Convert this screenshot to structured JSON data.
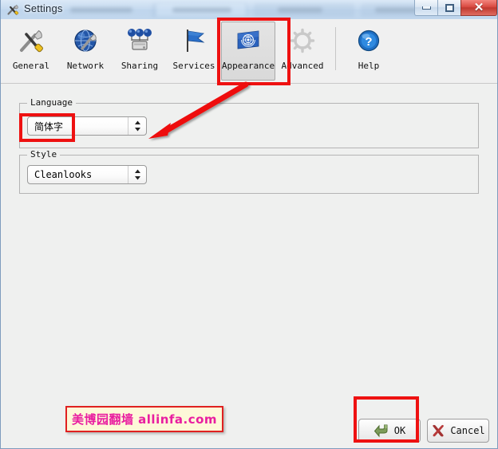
{
  "window": {
    "title": "Settings",
    "title_icon": "tools-icon",
    "controls": {
      "minimize": "minimize-icon",
      "maximize": "maximize-icon",
      "close": "✕"
    }
  },
  "toolbar": {
    "items": [
      {
        "label": "General",
        "icon": "tools-icon",
        "selected": false
      },
      {
        "label": "Network",
        "icon": "globe-wrench-icon",
        "selected": false
      },
      {
        "label": "Sharing",
        "icon": "network-share-icon",
        "selected": false
      },
      {
        "label": "Services",
        "icon": "flag-icon",
        "selected": false
      },
      {
        "label": "Appearance",
        "icon": "un-flag-icon",
        "selected": true
      },
      {
        "label": "Advanced",
        "icon": "gear-icon",
        "selected": false
      },
      {
        "label": "Help",
        "icon": "question-circle-icon",
        "selected": false
      }
    ]
  },
  "language_group": {
    "title": "Language",
    "combo_value": "简体字",
    "combo_icon": "up-down-arrows-icon"
  },
  "style_group": {
    "title": "Style",
    "combo_value": "Cleanlooks",
    "combo_icon": "up-down-arrows-icon"
  },
  "footer": {
    "ok_label": "OK",
    "ok_icon": "green-return-arrow-icon",
    "cancel_label": "Cancel",
    "cancel_icon": "red-x-icon"
  },
  "watermark": {
    "text": "美博园翻墙 allinfa.com"
  },
  "annotations": {
    "accent_color": "#ee1111",
    "highlight_appearance_tab": true,
    "highlight_language_combo": true,
    "highlight_ok_button": true,
    "arrow_from_tab_to_combo": true
  }
}
